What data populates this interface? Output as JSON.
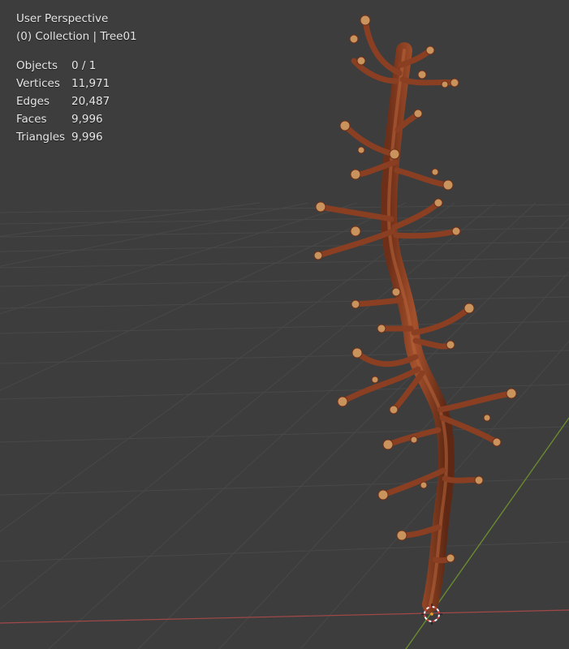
{
  "viewport": {
    "perspective_label": "User Perspective",
    "collection_label": "(0) Collection | Tree01",
    "stats": [
      {
        "label": "Objects",
        "value": "0 / 1"
      },
      {
        "label": "Vertices",
        "value": "11,971"
      },
      {
        "label": "Edges",
        "value": "20,487"
      },
      {
        "label": "Faces",
        "value": "9,996"
      },
      {
        "label": "Triangles",
        "value": "9,996"
      }
    ]
  },
  "colors": {
    "background": "#3d3d3d",
    "grid_line": "#4a4a4a",
    "x_axis": "#a34848",
    "y_axis": "#6a8a30",
    "bark": "#8a3e22",
    "bark_highlight": "#b0603a",
    "bud": "#c8935c"
  },
  "icons": {
    "scene_object": "tree-model-icon",
    "cursor": "3d-cursor-icon"
  }
}
